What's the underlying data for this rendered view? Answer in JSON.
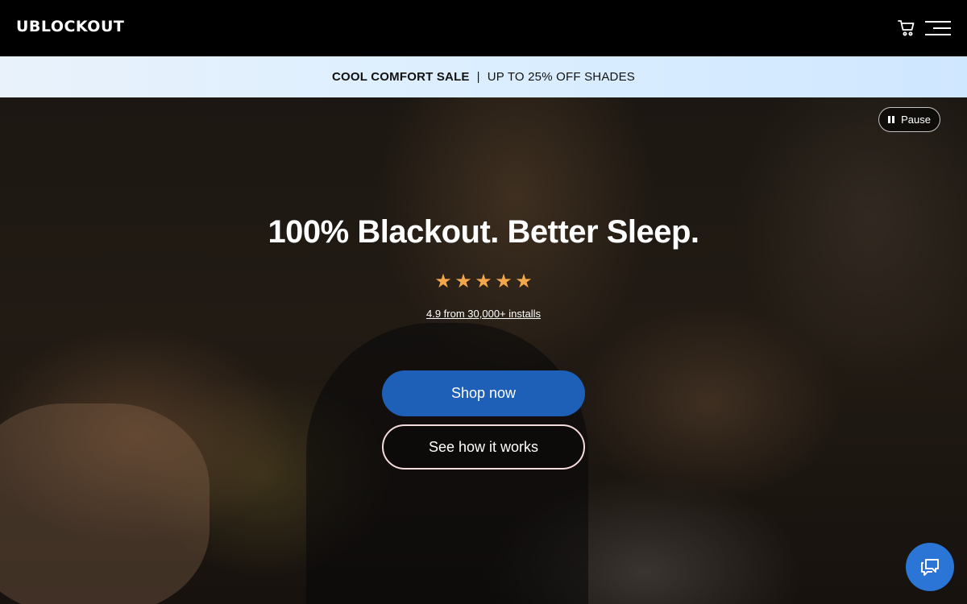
{
  "header": {
    "logo": "UBLOCKOUT",
    "cart_icon": "cart-icon",
    "menu_icon": "hamburger-menu-icon"
  },
  "promo": {
    "sale_name": "COOL COMFORT SALE",
    "separator": "|",
    "offer": "UP TO 25% OFF SHADES"
  },
  "hero": {
    "pause_label": "Pause",
    "pause_icon": "pause-icon",
    "headline": "100% Blackout. Better Sleep.",
    "stars": [
      "★",
      "★",
      "★",
      "★",
      "★"
    ],
    "rating_text": "4.9 from 30,000+ installs",
    "primary_cta": "Shop now",
    "secondary_cta": "See how it works"
  },
  "chat": {
    "icon": "chat-bubble-icon"
  },
  "colors": {
    "accent_blue": "#1e5fb8",
    "chat_blue": "#2a75d6",
    "star_orange": "#f3a64a",
    "promo_bg": "#dbeeff"
  }
}
